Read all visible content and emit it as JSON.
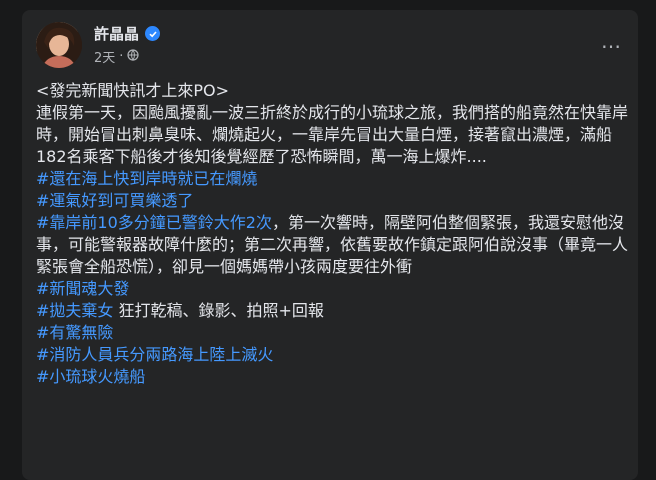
{
  "author": {
    "name": "許晶晶",
    "timestamp": "2天",
    "verified_icon": "verified-badge-icon",
    "privacy_icon": "globe-icon"
  },
  "more_button": "…",
  "colors": {
    "background": "#18191a",
    "card": "#242526",
    "text": "#e4e6eb",
    "hashtag": "#4599ff",
    "secondary": "#b0b3b8"
  },
  "post": {
    "line1": "<發完新聞快訊才上來PO>",
    "para1": "連假第一天，因颱風擾亂一波三折終於成行的小琉球之旅，我們搭的船竟然在快靠岸時，開始冒出刺鼻臭味、爛燒起火，一靠岸先冒出大量白煙，接著竄出濃煙，滿船182名乘客下船後才後知後覺經歷了恐怖瞬間，萬一海上爆炸....",
    "tag1": "#還在海上快到岸時就已在爛燒",
    "tag2": "#運氣好到可買樂透了",
    "tag3": "#靠岸前10多分鐘已警鈴大作2次",
    "para2": "，第一次響時，隔壁阿伯整個緊張，我還安慰他沒事，可能警報器故障什麼的；第二次再響，依舊要故作鎮定跟阿伯說沒事（畢竟一人緊張會全船恐慌），卻見一個媽媽帶小孩兩度要往外衝",
    "tag4": "#新聞魂大發",
    "tag5": "#拋夫棄女",
    "para3": " 狂打乾稿、錄影、拍照+回報",
    "tag6": "#有驚無險",
    "tag7": "#消防人員兵分兩路海上陸上滅火",
    "tag8": "#小琉球火燒船"
  }
}
